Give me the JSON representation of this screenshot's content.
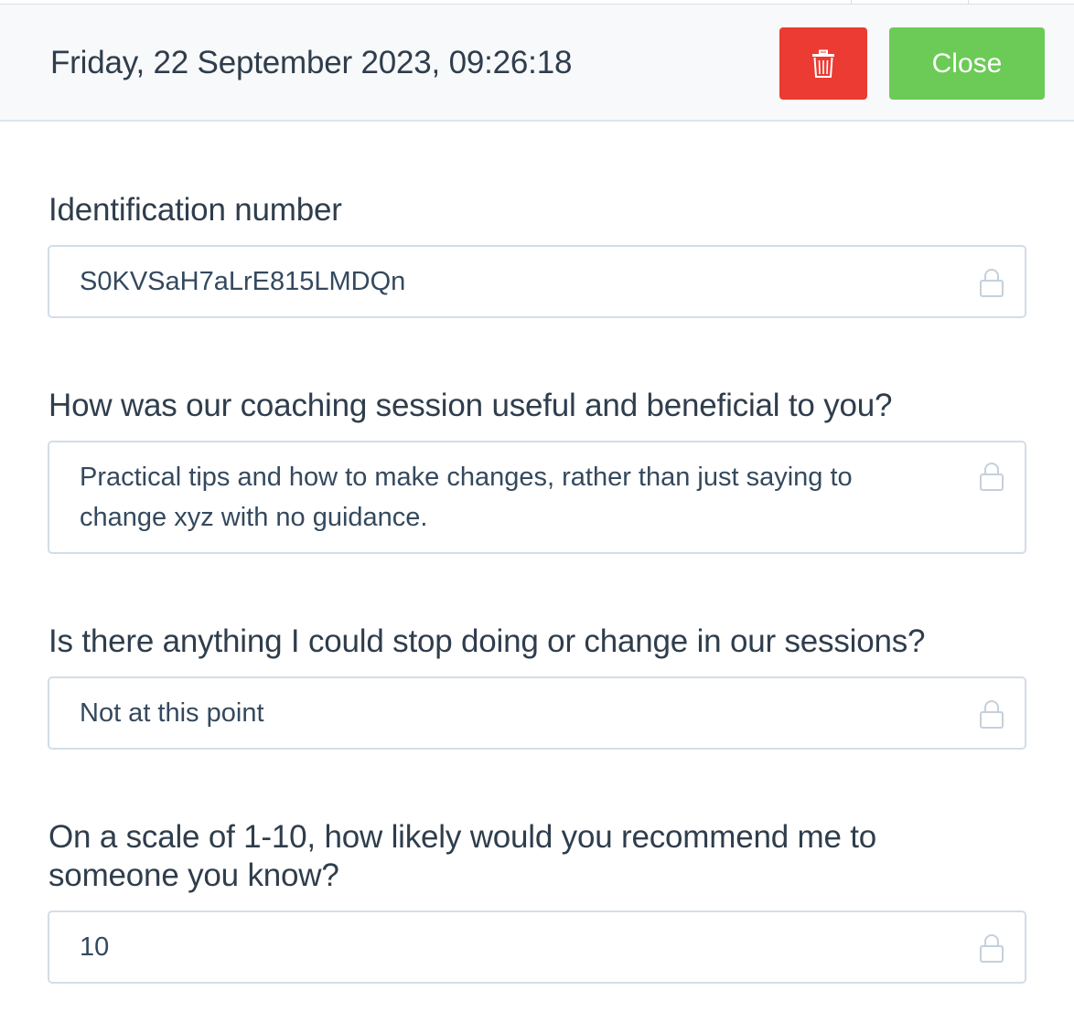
{
  "header": {
    "title": "Friday, 22 September 2023, 09:26:18",
    "close_label": "Close",
    "delete_icon": "trash-icon"
  },
  "fields": [
    {
      "label": "Identification number",
      "value": "S0KVSaH7aLrE815LMDQn",
      "icon": "lock-icon"
    },
    {
      "label": "How was our coaching session useful and beneficial to you?",
      "value": "Practical tips and how to make changes, rather than just saying to change xyz with no guidance.",
      "icon": "lock-icon"
    },
    {
      "label": "Is there anything I could stop doing or change in our sessions?",
      "value": "Not at this point",
      "icon": "lock-icon"
    },
    {
      "label": "On a scale of 1-10, how likely would you recommend me to someone you know?",
      "value": "10",
      "icon": "lock-icon"
    }
  ],
  "colors": {
    "delete": "#ec3b32",
    "close": "#6ccb56",
    "border": "#d3dde8",
    "text": "#2f3d4c"
  }
}
